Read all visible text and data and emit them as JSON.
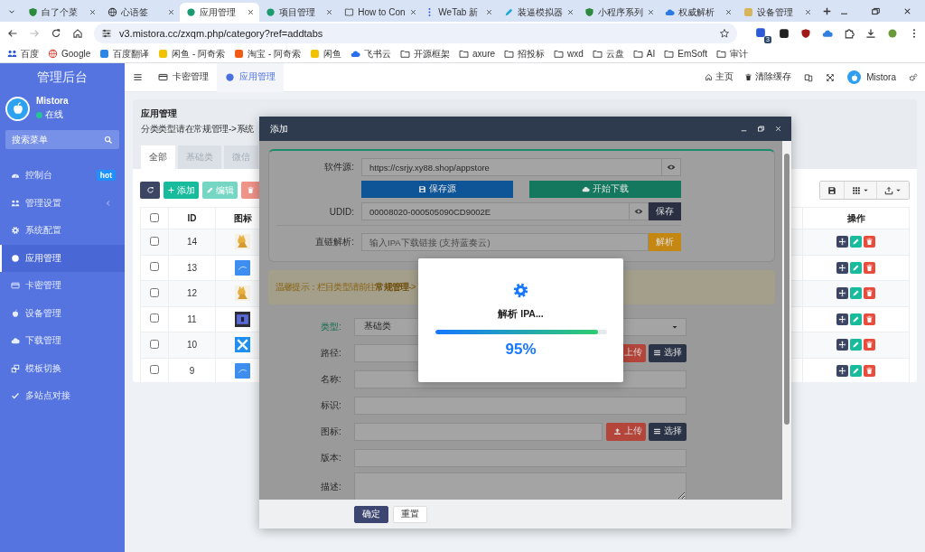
{
  "browser": {
    "tabs": [
      {
        "title": "白了个菜",
        "selected": false
      },
      {
        "title": "心语签",
        "selected": false
      },
      {
        "title": "应用管理",
        "selected": true
      },
      {
        "title": "项目管理",
        "selected": false
      },
      {
        "title": "How to Con",
        "selected": false
      },
      {
        "title": "WeTab 新",
        "selected": false
      },
      {
        "title": "装逼模拟器",
        "selected": false
      },
      {
        "title": "小程序系列",
        "selected": false
      },
      {
        "title": "权威解析",
        "selected": false
      },
      {
        "title": "设备管理",
        "selected": false
      }
    ],
    "address": "v3.mistora.cc/zxqm.php/category?ref=addtabs",
    "extension_badge": "3",
    "bookmarks": [
      {
        "label": "百度",
        "kind": "site"
      },
      {
        "label": "Google",
        "kind": "site"
      },
      {
        "label": "百度翻译",
        "kind": "site"
      },
      {
        "label": "闲鱼 - 阿奇索",
        "kind": "site"
      },
      {
        "label": "淘宝 - 阿奇索",
        "kind": "site"
      },
      {
        "label": "闲鱼",
        "kind": "site"
      },
      {
        "label": "飞书云",
        "kind": "site"
      },
      {
        "label": "开源框架",
        "kind": "folder"
      },
      {
        "label": "axure",
        "kind": "folder"
      },
      {
        "label": "招投标",
        "kind": "folder"
      },
      {
        "label": "wxd",
        "kind": "folder"
      },
      {
        "label": "云盘",
        "kind": "folder"
      },
      {
        "label": "AI",
        "kind": "folder"
      },
      {
        "label": "EmSoft",
        "kind": "folder"
      },
      {
        "label": "审计",
        "kind": "folder"
      }
    ]
  },
  "sidebar": {
    "title": "管理后台",
    "user": {
      "name": "Mistora",
      "status": "在线"
    },
    "search": {
      "placeholder": "搜索菜单"
    },
    "items": [
      {
        "label": "控制台",
        "kind": "link",
        "badge": "hot",
        "selected": false
      },
      {
        "label": "管理设置",
        "kind": "group",
        "selected": false
      },
      {
        "label": "系统配置",
        "kind": "link",
        "selected": false
      },
      {
        "label": "应用管理",
        "kind": "link",
        "selected": true
      },
      {
        "label": "卡密管理",
        "kind": "link",
        "selected": false
      },
      {
        "label": "设备管理",
        "kind": "link",
        "selected": false
      },
      {
        "label": "下载管理",
        "kind": "link",
        "selected": false
      },
      {
        "label": "模板切换",
        "kind": "link",
        "selected": false
      },
      {
        "label": "多站点对接",
        "kind": "link",
        "selected": false
      }
    ]
  },
  "header": {
    "tabs": [
      {
        "label": "卡密管理",
        "selected": false
      },
      {
        "label": "应用管理",
        "selected": true
      }
    ],
    "links": [
      "主页",
      "清除缓存"
    ],
    "user": "Mistora"
  },
  "page": {
    "title": "应用管理",
    "note": "分类类型请在常规管理->系统",
    "tabs": [
      {
        "label": "全部",
        "selected": true
      },
      {
        "label": "基础类",
        "selected": false
      },
      {
        "label": "微信",
        "selected": false
      }
    ],
    "toolbar": [
      {
        "label": "添加",
        "kind": "add",
        "disabled": false
      },
      {
        "label": "编辑",
        "kind": "edit",
        "disabled": true
      },
      {
        "kind": "delete",
        "disabled": true
      }
    ],
    "table": {
      "select_all_checked": false,
      "columns": [
        "ID",
        "图标",
        "操作"
      ],
      "rows": [
        {
          "id": "14",
          "checked": false
        },
        {
          "id": "13",
          "checked": false
        },
        {
          "id": "12",
          "checked": false
        },
        {
          "id": "11",
          "checked": false
        },
        {
          "id": "10",
          "checked": false
        },
        {
          "id": "9",
          "checked": false
        }
      ]
    }
  },
  "modal": {
    "title": "添加",
    "source": {
      "label": "软件源:",
      "value": "https://csrjy.xy88.shop/appstore"
    },
    "source_buttons": [
      {
        "label": "保存源",
        "kind": "save"
      },
      {
        "label": "开始下载",
        "kind": "download"
      }
    ],
    "udid": {
      "label": "UDID:",
      "value": "00008020-000505090CD9002E",
      "button": "保存"
    },
    "direct": {
      "label": "直链解析:",
      "placeholder": "输入IPA下载链接 (支持蓝奏云)",
      "button": "解析"
    },
    "notice": "温馨提示：栏目类型请前往**常规管理**->",
    "fields": [
      {
        "label": "类型:",
        "kind": "select",
        "value": "基础类",
        "highlighted": true
      },
      {
        "label": "路径:",
        "kind": "file",
        "buttons": [
          "上传",
          "选择"
        ],
        "highlighted": false
      },
      {
        "label": "名称:",
        "kind": "text",
        "highlighted": false
      },
      {
        "label": "标识:",
        "kind": "text",
        "highlighted": false
      },
      {
        "label": "图标:",
        "kind": "file",
        "buttons": [
          "上传",
          "选择"
        ],
        "highlighted": false
      },
      {
        "label": "版本:",
        "kind": "text",
        "highlighted": false
      },
      {
        "label": "描述:",
        "kind": "textarea",
        "highlighted": false
      }
    ],
    "footer": [
      {
        "label": "确定",
        "kind": "primary"
      },
      {
        "label": "重置",
        "kind": "default"
      }
    ],
    "loading": {
      "text": "解析 IPA...",
      "level": 0.95,
      "percent": "95%"
    }
  }
}
